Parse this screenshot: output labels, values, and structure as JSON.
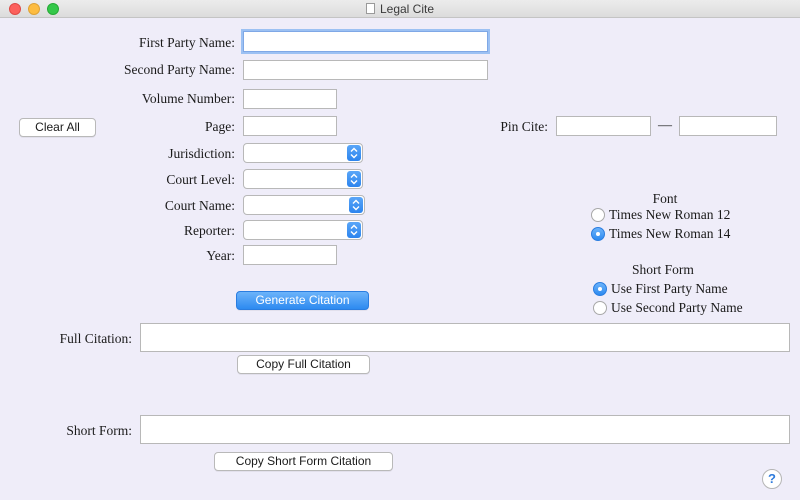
{
  "window": {
    "title": "Legal Cite"
  },
  "fields": {
    "first_party_label": "First Party Name:",
    "second_party_label": "Second Party Name:",
    "volume_label": "Volume Number:",
    "page_label": "Page:",
    "pin_cite_label": "Pin Cite:",
    "pin_cite_separator": "—",
    "jurisdiction_label": "Jurisdiction:",
    "court_level_label": "Court Level:",
    "court_name_label": "Court Name:",
    "reporter_label": "Reporter:",
    "year_label": "Year:",
    "full_citation_label": "Full Citation:",
    "short_form_label": "Short Form:"
  },
  "buttons": {
    "clear_all": "Clear All",
    "generate": "Generate Citation",
    "copy_full": "Copy Full Citation",
    "copy_short": "Copy Short Form Citation",
    "help": "?"
  },
  "font_group": {
    "title": "Font",
    "options": [
      "Times New Roman 12",
      "Times New Roman 14"
    ],
    "selected": 1
  },
  "short_form_group": {
    "title": "Short Form",
    "options": [
      "Use First Party Name",
      "Use Second Party Name"
    ],
    "selected": 0
  },
  "colors": {
    "accent": "#2d8af0",
    "background": "#efedf9",
    "focus_ring": "#9cc1f3"
  }
}
